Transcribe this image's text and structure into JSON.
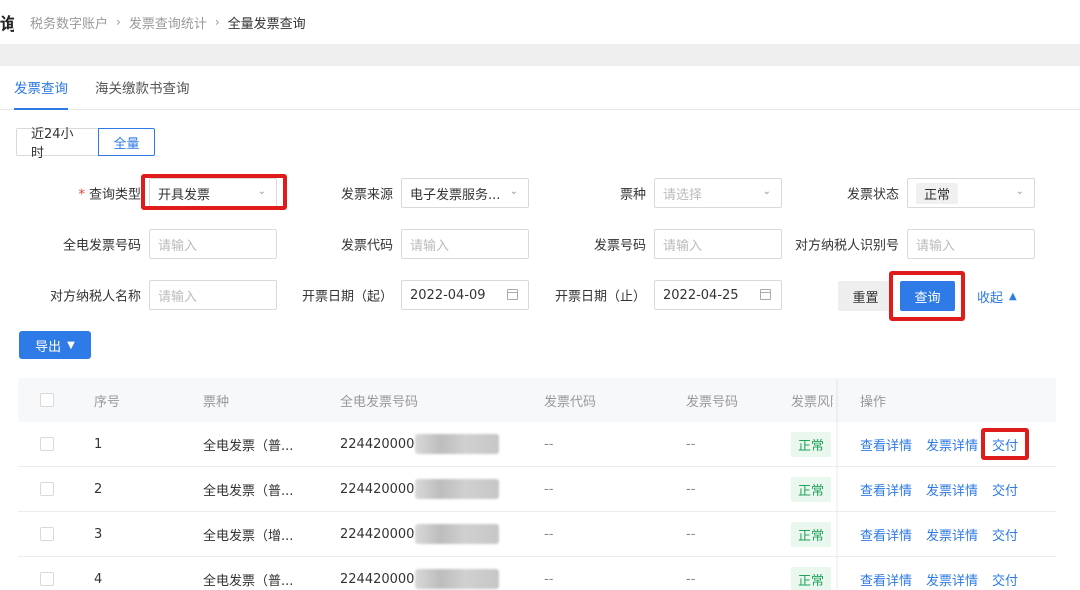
{
  "header": {
    "title_char": "询",
    "breadcrumb": [
      "税务数字账户",
      "发票查询统计",
      "全量发票查询"
    ],
    "breadcrumb_sep": "›"
  },
  "tabs": [
    {
      "label": "发票查询",
      "active": true
    },
    {
      "label": "海关缴款书查询",
      "active": false
    }
  ],
  "range": {
    "options": [
      "近24小时",
      "全量"
    ],
    "selected": "全量"
  },
  "filters": {
    "query_type": {
      "required_mark": "*",
      "label": "查询类型",
      "value": "开具发票"
    },
    "invoice_source": {
      "label": "发票来源",
      "value": "电子发票服务..."
    },
    "ticket_type": {
      "label": "票种",
      "placeholder": "请选择"
    },
    "invoice_status": {
      "label": "发票状态",
      "value": "正常"
    },
    "full_invoice_no": {
      "label": "全电发票号码",
      "placeholder": "请输入"
    },
    "invoice_code": {
      "label": "发票代码",
      "placeholder": "请输入"
    },
    "invoice_no": {
      "label": "发票号码",
      "placeholder": "请输入"
    },
    "counterparty_tax_id": {
      "label": "对方纳税人识别号",
      "placeholder": "请输入"
    },
    "counterparty_name": {
      "label": "对方纳税人名称",
      "placeholder": "请输入"
    },
    "date_start": {
      "label": "开票日期（起）",
      "value": "2022-04-09"
    },
    "date_end": {
      "label": "开票日期（止）",
      "value": "2022-04-25"
    }
  },
  "actions": {
    "reset": "重置",
    "query": "查询",
    "collapse": "收起",
    "export": "导出"
  },
  "table": {
    "columns": [
      "序号",
      "票种",
      "全电发票号码",
      "发票代码",
      "发票号码",
      "发票风险",
      "操作"
    ],
    "rows": [
      {
        "index": "1",
        "type": "全电发票（普...",
        "number_prefix": "224420000",
        "code": "--",
        "no": "--",
        "status": "正常"
      },
      {
        "index": "2",
        "type": "全电发票（普...",
        "number_prefix": "224420000",
        "code": "--",
        "no": "--",
        "status": "正常"
      },
      {
        "index": "3",
        "type": "全电发票（增...",
        "number_prefix": "224420000",
        "code": "--",
        "no": "--",
        "status": "正常"
      },
      {
        "index": "4",
        "type": "全电发票（普...",
        "number_prefix": "224420000",
        "code": "--",
        "no": "--",
        "status": "正常"
      }
    ],
    "row_actions": [
      "查看详情",
      "发票详情",
      "交付"
    ]
  },
  "colors": {
    "accent": "#2e7ae6",
    "highlight": "#e01b1b",
    "status_green": "#21a35a"
  }
}
